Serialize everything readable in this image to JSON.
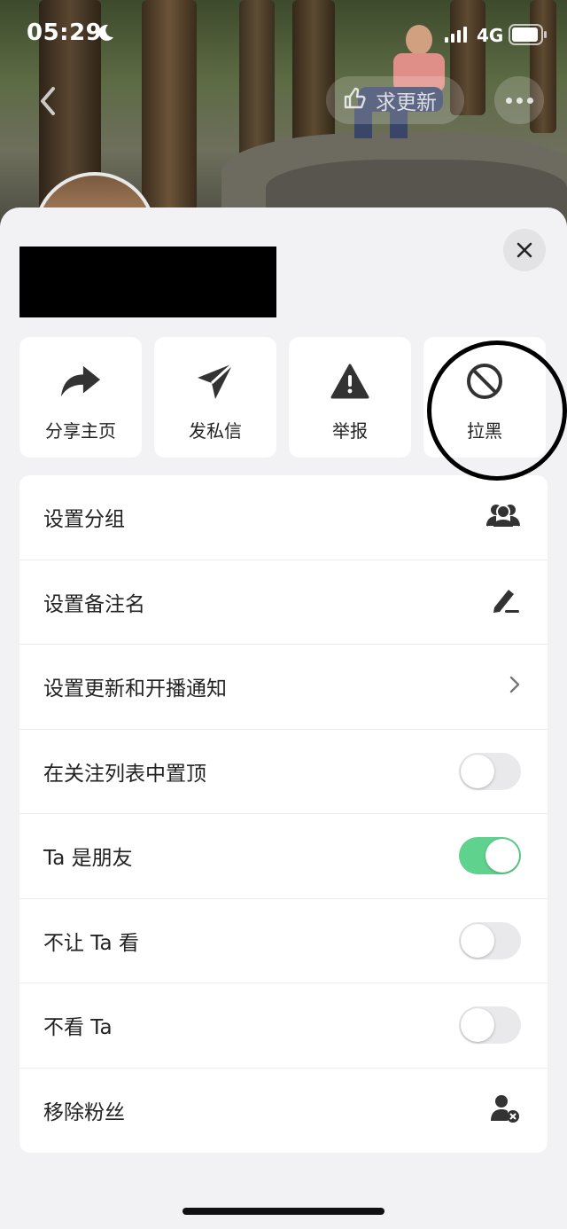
{
  "status_bar": {
    "time": "05:29",
    "network": "4G"
  },
  "header": {
    "request_update_label": "求更新"
  },
  "profile": {
    "name_visible": ""
  },
  "actions": [
    {
      "label": "分享主页",
      "icon": "share-arrow-icon"
    },
    {
      "label": "发私信",
      "icon": "paper-plane-icon"
    },
    {
      "label": "举报",
      "icon": "warning-icon"
    },
    {
      "label": "拉黑",
      "icon": "block-icon"
    }
  ],
  "settings": [
    {
      "label": "设置分组",
      "control": "group-icon"
    },
    {
      "label": "设置备注名",
      "control": "pencil-icon"
    },
    {
      "label": "设置更新和开播通知",
      "control": "chevron-right-icon"
    },
    {
      "label": "在关注列表中置顶",
      "control": "toggle",
      "on": false
    },
    {
      "label": "Ta 是朋友",
      "control": "toggle",
      "on": true
    },
    {
      "label": "不让 Ta 看",
      "control": "toggle",
      "on": false
    },
    {
      "label": "不看 Ta",
      "control": "toggle",
      "on": false
    },
    {
      "label": "移除粉丝",
      "control": "remove-follower-icon"
    }
  ],
  "colors": {
    "toggle_on": "#5fd38d",
    "toggle_off": "#e9e9eb",
    "sheet_bg": "#f2f2f4"
  }
}
